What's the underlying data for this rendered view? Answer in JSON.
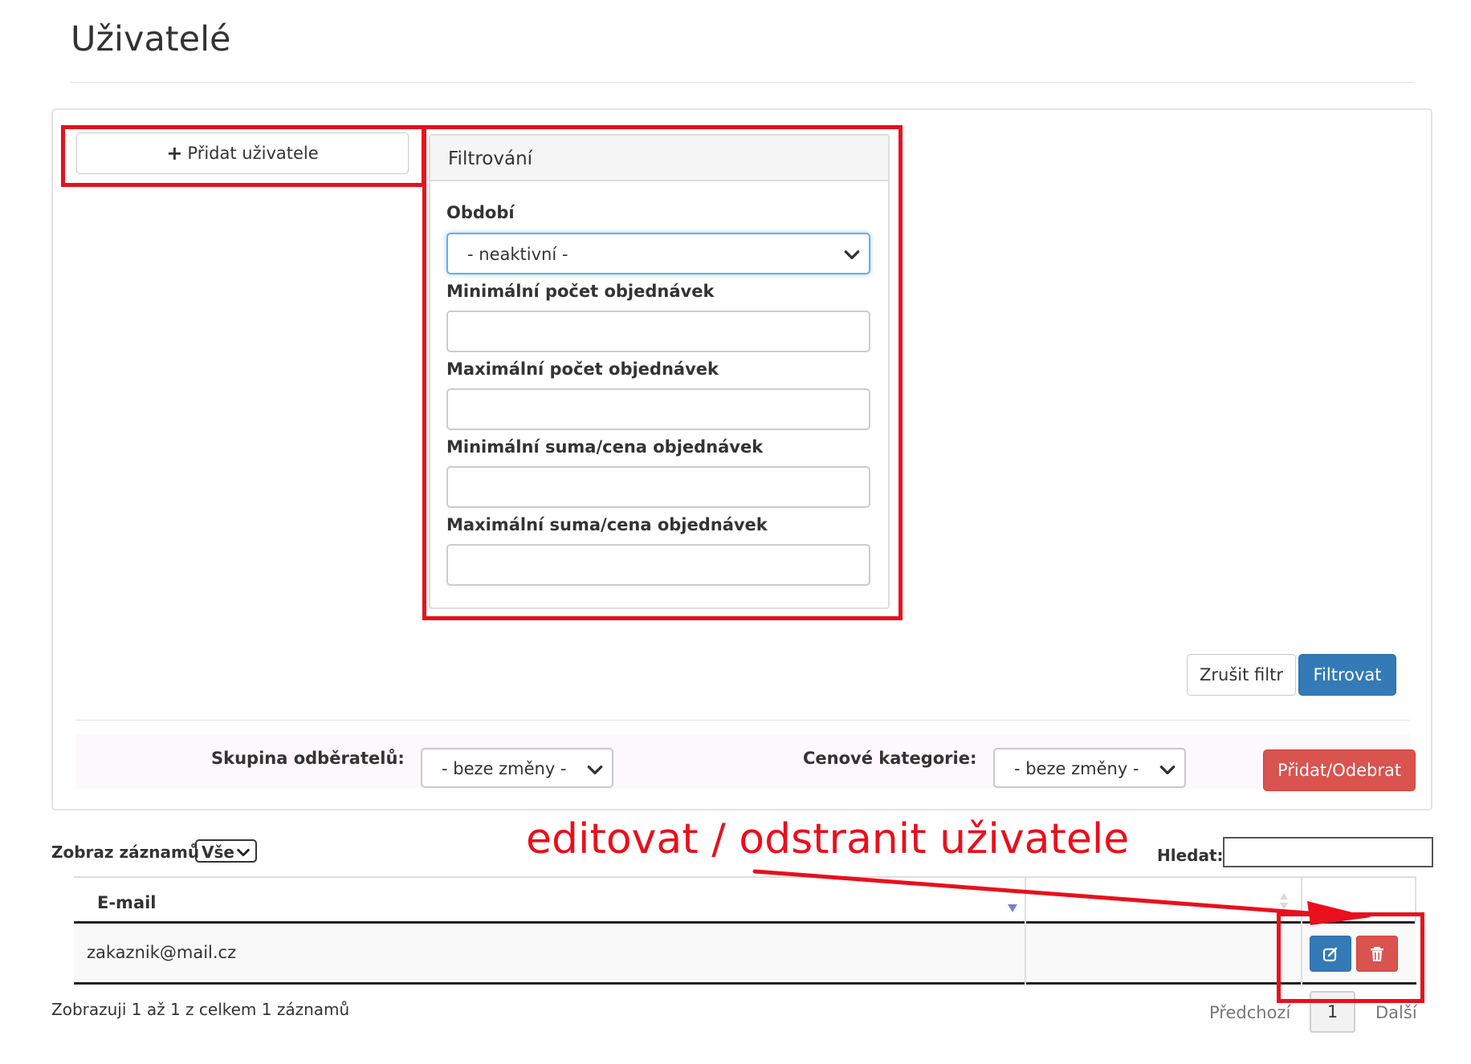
{
  "page": {
    "title": "Uživatelé"
  },
  "toolbar": {
    "add_user_label": "Přidat uživatele"
  },
  "filter": {
    "heading": "Filtrování",
    "period_label": "Období",
    "period_value": "- neaktivní -",
    "min_orders_label": "Minimální počet objednávek",
    "max_orders_label": "Maximální počet objednávek",
    "min_sum_label": "Minimální suma/cena objednávek",
    "max_sum_label": "Maximální suma/cena objednávek",
    "min_orders_value": "",
    "max_orders_value": "",
    "min_sum_value": "",
    "max_sum_value": "",
    "clear_label": "Zrušit filtr",
    "apply_label": "Filtrovat"
  },
  "mass": {
    "group_label": "Skupina odběratelů:",
    "group_value": "- beze změny -",
    "price_label": "Cenové kategorie:",
    "price_value": "- beze změny -",
    "action_label": "Přidat/Odebrat"
  },
  "annotation": {
    "text": "editovat / odstranit uživatele"
  },
  "list": {
    "length_label": "Zobraz záznamů",
    "length_value": "Vše",
    "search_label": "Hledat:",
    "search_value": "",
    "columns": [
      "E-mail",
      "",
      ""
    ],
    "rows": [
      {
        "email": "zakaznik@mail.cz"
      }
    ],
    "info": "Zobrazuji 1 až 1 z celkem 1 záznamů",
    "prev_label": "Předchozí",
    "current_page": "1",
    "next_label": "Další"
  },
  "colors": {
    "primary": "#337ab7",
    "danger": "#d9534f",
    "annotation_red": "#e8101d"
  },
  "icons": [
    "plus-icon",
    "chevron-down-icon",
    "sort-desc-icon",
    "sort-both-icon",
    "edit-icon",
    "trash-icon"
  ]
}
